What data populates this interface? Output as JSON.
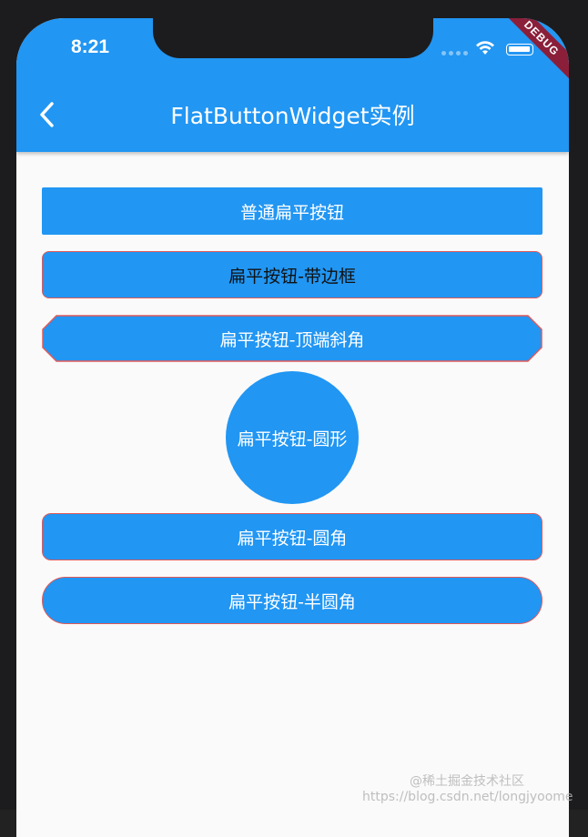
{
  "status_bar": {
    "time": "8:21",
    "debug_label": "DEBUG"
  },
  "app_bar": {
    "title": "FlatButtonWidget实例",
    "back_icon": "chevron-left-icon"
  },
  "buttons": [
    {
      "label": "普通扁平按钮"
    },
    {
      "label": "扁平按钮-带边框"
    },
    {
      "label": "扁平按钮-顶端斜角"
    },
    {
      "label": "扁平按钮-圆形"
    },
    {
      "label": "扁平按钮-圆角"
    },
    {
      "label": "扁平按钮-半圆角"
    }
  ],
  "watermark": {
    "line1": "@稀土掘金技术社区",
    "line2": "https://blog.csdn.net/longjyoome"
  },
  "colors": {
    "primary": "#2196f3",
    "border": "#e05a5a",
    "background": "#fafafa",
    "debug": "#8b1f3a"
  }
}
